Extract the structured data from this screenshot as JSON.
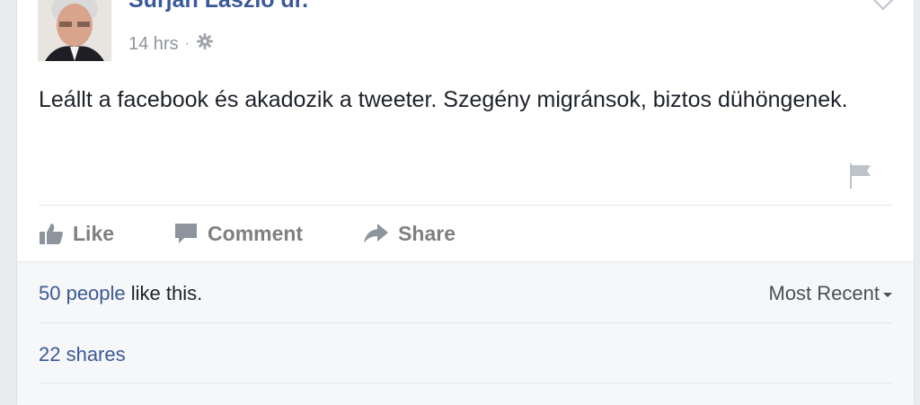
{
  "post": {
    "author": "Surján László dr.",
    "time": "14 hrs",
    "separator": "·",
    "privacy_icon": "gear-icon",
    "text": "Leállt a facebook és akadozik a tweeter. Szegény migránsok, biztos dühöngenek.",
    "report_icon": "flag-icon",
    "menu_icon": "chevron-down-icon"
  },
  "actions": {
    "like_label": "Like",
    "comment_label": "Comment",
    "share_label": "Share"
  },
  "footer": {
    "likes_link": "50 people",
    "likes_suffix": " like this.",
    "sort_label": "Most Recent",
    "shares_label": "22 shares"
  },
  "colors": {
    "link": "#3b5998",
    "action_text": "#7f7f7f",
    "footer_bg": "#f6f7f9"
  }
}
